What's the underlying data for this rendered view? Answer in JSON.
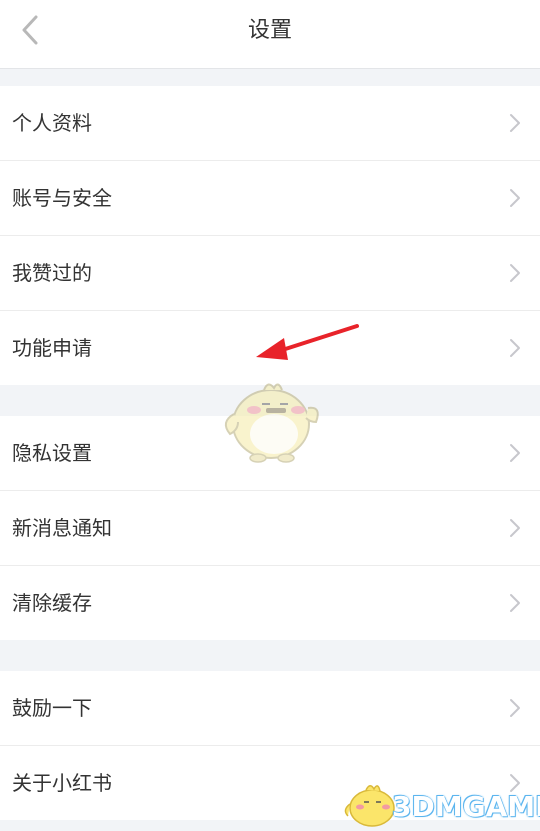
{
  "header": {
    "title": "设置",
    "back_icon": "chevron-left-icon"
  },
  "groups": [
    {
      "items": [
        {
          "label": "个人资料"
        },
        {
          "label": "账号与安全"
        },
        {
          "label": "我赞过的"
        },
        {
          "label": "功能申请"
        }
      ]
    },
    {
      "items": [
        {
          "label": "隐私设置"
        },
        {
          "label": "新消息通知"
        },
        {
          "label": "清除缓存"
        }
      ]
    },
    {
      "items": [
        {
          "label": "鼓励一下"
        },
        {
          "label": "关于小红书"
        }
      ]
    }
  ],
  "annotation": {
    "icon": "red-arrow-annotation",
    "color": "#e8232a"
  },
  "overlay": {
    "icon": "chick-mascot"
  },
  "watermark": {
    "text": "3DMGAME",
    "icon": "chick-mascot-small",
    "color": "#5fb8f0"
  },
  "colors": {
    "background": "#f2f4f7",
    "row": "#ffffff",
    "chevron": "#c7c7cc",
    "text": "#333333"
  }
}
